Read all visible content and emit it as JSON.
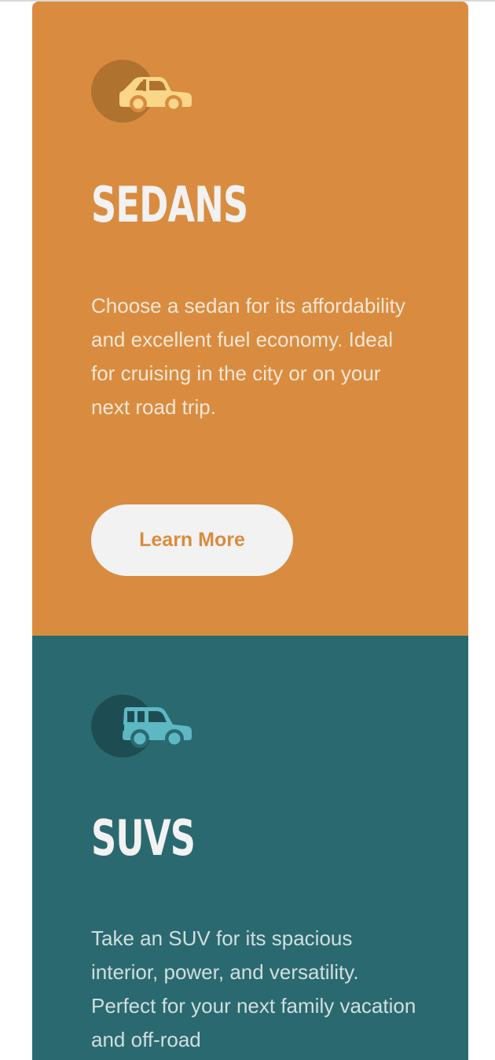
{
  "sedans": {
    "title": "SEDANS",
    "description": "Choose a sedan for its affordability and excellent fuel economy. Ideal for cruising in the city or on your next road trip.",
    "button_label": "Learn More",
    "icon": "sedan-car-icon",
    "colors": {
      "background": "#d98c3f",
      "icon_circle": "#b0722f",
      "icon_car": "#fad689"
    }
  },
  "suvs": {
    "title": "SUVS",
    "description": "Take an SUV for its spacious interior, power, and versatility. Perfect for your next family vacation and off-road",
    "icon": "suv-car-icon",
    "colors": {
      "background": "#2b6970",
      "icon_circle": "#1d4d52",
      "icon_car": "#5db8c4"
    }
  }
}
